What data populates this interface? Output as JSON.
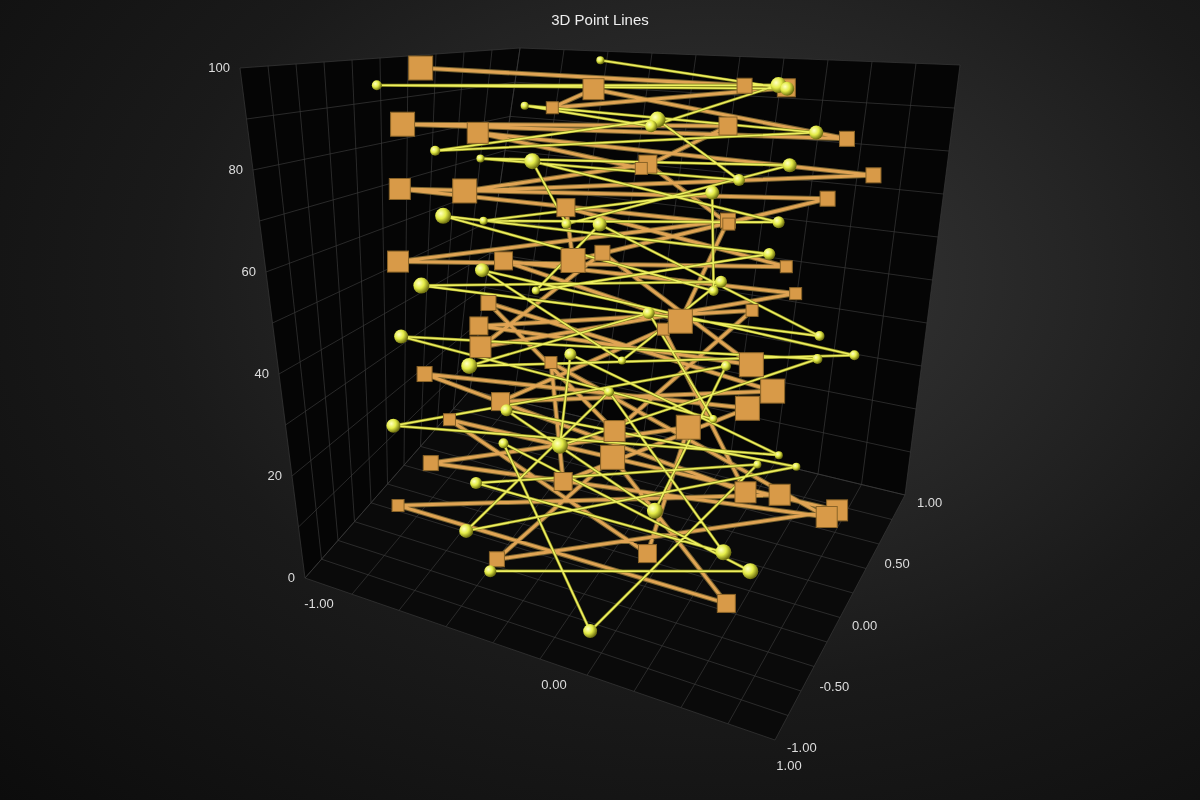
{
  "title": "3D Point Lines",
  "y_axis": {
    "ticks": [
      "0",
      "20",
      "40",
      "60",
      "80",
      "100"
    ]
  },
  "x_axis": {
    "ticks": [
      "-1.00",
      "0.00",
      "1.00"
    ]
  },
  "z_axis": {
    "ticks": [
      "-1.00",
      "-0.50",
      "0.00",
      "0.50",
      "1.00"
    ]
  }
}
